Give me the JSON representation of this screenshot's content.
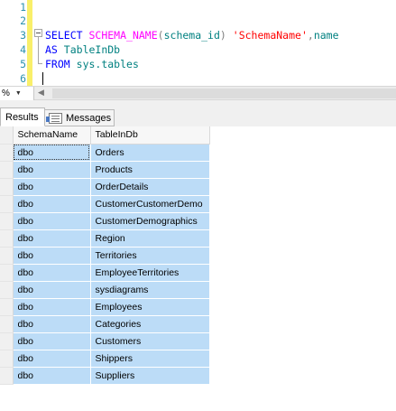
{
  "editor": {
    "line_numbers": [
      "1",
      "2",
      "3",
      "4",
      "5",
      "6"
    ],
    "line3": {
      "kw_select": "SELECT",
      "fn_schema_name": "SCHEMA_NAME",
      "paren_open": "(",
      "arg": "schema_id",
      "paren_close": ")",
      "str_alias": "'SchemaName'",
      "comma": ",",
      "col_name": "name"
    },
    "line4": {
      "kw_as": "AS",
      "alias": "TableInDb"
    },
    "line5": {
      "kw_from": "FROM",
      "table": "sys.tables"
    }
  },
  "zoom": {
    "value": "%",
    "arrow_icon": "chevron-down-icon"
  },
  "tabs": {
    "results_label": "Results",
    "messages_label": "Messages",
    "messages_icon": "messages-icon",
    "active": "Results"
  },
  "grid": {
    "columns": [
      "SchemaName",
      "TableInDb"
    ],
    "rows": [
      [
        "dbo",
        "Orders"
      ],
      [
        "dbo",
        "Products"
      ],
      [
        "dbo",
        "OrderDetails"
      ],
      [
        "dbo",
        "CustomerCustomerDemo"
      ],
      [
        "dbo",
        "CustomerDemographics"
      ],
      [
        "dbo",
        "Region"
      ],
      [
        "dbo",
        "Territories"
      ],
      [
        "dbo",
        "EmployeeTerritories"
      ],
      [
        "dbo",
        "sysdiagrams"
      ],
      [
        "dbo",
        "Employees"
      ],
      [
        "dbo",
        "Categories"
      ],
      [
        "dbo",
        "Customers"
      ],
      [
        "dbo",
        "Shippers"
      ],
      [
        "dbo",
        "Suppliers"
      ]
    ]
  },
  "colors": {
    "keyword": "#0000ff",
    "function": "#ff00ff",
    "string": "#ff0000",
    "identifier": "#008080",
    "line_number": "#2b91af",
    "selection": "#bcdcf7",
    "change_bar": "#f9ef6a"
  }
}
